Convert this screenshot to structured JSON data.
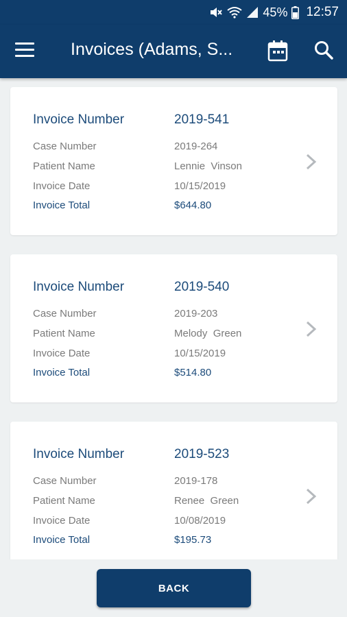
{
  "status_bar": {
    "battery": "45%",
    "time": "12:57"
  },
  "app_bar": {
    "title": "Invoices (Adams, S..."
  },
  "labels": {
    "invoice_number": "Invoice Number",
    "case_number": "Case Number",
    "patient_name": "Patient Name",
    "invoice_date": "Invoice Date",
    "invoice_total": "Invoice Total"
  },
  "invoices": [
    {
      "invoice_number": "2019-541",
      "case_number": "2019-264",
      "patient_name": "Lennie  Vinson",
      "invoice_date": "10/15/2019",
      "invoice_total": "$644.80"
    },
    {
      "invoice_number": "2019-540",
      "case_number": "2019-203",
      "patient_name": "Melody  Green",
      "invoice_date": "10/15/2019",
      "invoice_total": "$514.80"
    },
    {
      "invoice_number": "2019-523",
      "case_number": "2019-178",
      "patient_name": "Renee  Green",
      "invoice_date": "10/08/2019",
      "invoice_total": "$195.73"
    }
  ],
  "back_button": {
    "label": "BACK"
  },
  "colors": {
    "primary": "#0f3d6b",
    "accent_text": "#1c4b7a",
    "muted_text": "#7a7a7a",
    "background": "#eef1f2"
  }
}
